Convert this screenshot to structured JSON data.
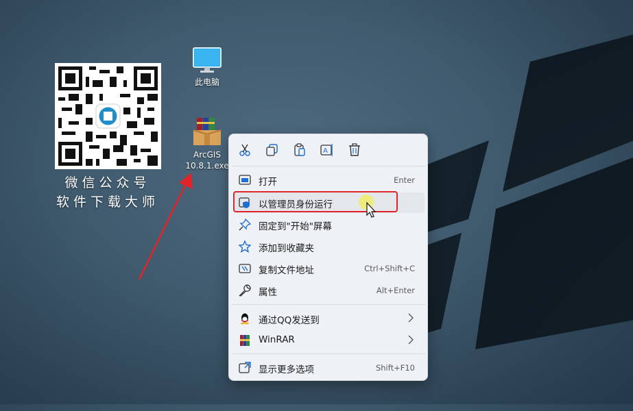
{
  "desktop": {
    "icons": [
      {
        "name": "computer",
        "label": "此电脑"
      },
      {
        "name": "exe",
        "label_line1": "ArcGIS",
        "label_line2": "10.8.1.exe"
      }
    ],
    "qr_caption_line1": "微信公众号",
    "qr_caption_line2": "软件下载大师"
  },
  "context_menu": {
    "toolbar": [
      "cut-icon",
      "copy-icon",
      "paste-icon",
      "rename-icon",
      "delete-icon"
    ],
    "items": [
      {
        "icon": "open-window-icon",
        "label": "打开",
        "shortcut": "Enter"
      },
      {
        "icon": "shield-admin-icon",
        "label": "以管理员身份运行",
        "shortcut": ""
      },
      {
        "icon": "pin-icon",
        "label": "固定到\"开始\"屏幕",
        "shortcut": ""
      },
      {
        "icon": "star-icon",
        "label": "添加到收藏夹",
        "shortcut": ""
      },
      {
        "icon": "copy-path-icon",
        "label": "复制文件地址",
        "shortcut": "Ctrl+Shift+C"
      },
      {
        "icon": "wrench-icon",
        "label": "属性",
        "shortcut": "Alt+Enter"
      },
      {
        "icon": "qq-icon",
        "label": "通过QQ发送到",
        "shortcut": ""
      },
      {
        "icon": "winrar-icon",
        "label": "WinRAR",
        "shortcut": ""
      },
      {
        "icon": "more-options-icon",
        "label": "显示更多选项",
        "shortcut": "Shift+F10"
      }
    ]
  },
  "colors": {
    "highlight_border": "#e0242a",
    "arrow": "#e0242a",
    "accent": "#1f6fd1"
  }
}
